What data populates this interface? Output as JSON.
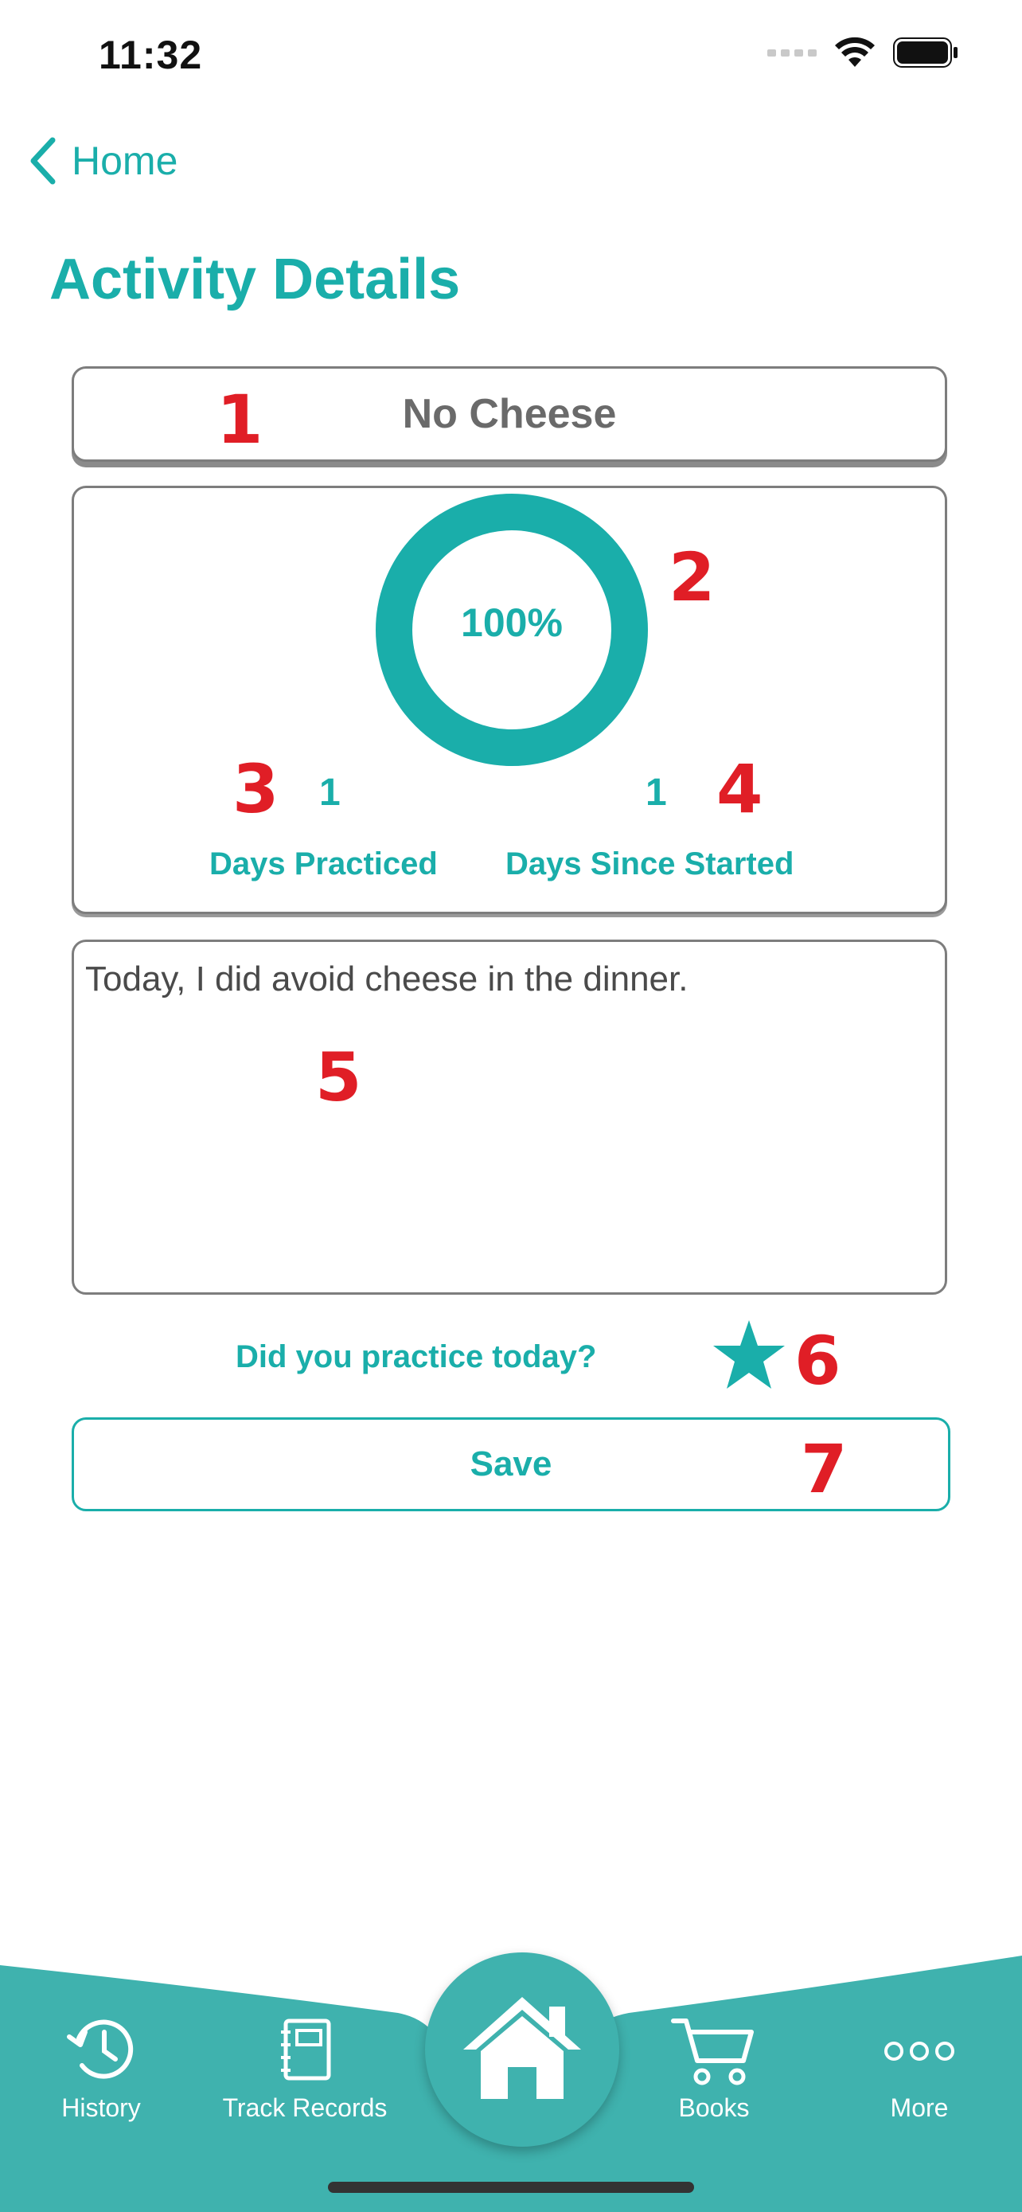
{
  "status_bar": {
    "time": "11:32"
  },
  "nav": {
    "back_label": "Home",
    "title": "Activity Details"
  },
  "activity": {
    "name": "No Cheese"
  },
  "progress": {
    "percent_label": "100%",
    "percent": 100
  },
  "stats": {
    "days_practiced_value": "1",
    "days_practiced_label": "Days Practiced",
    "days_since_started_value": "1",
    "days_since_started_label": "Days Since Started"
  },
  "notes": {
    "text": "Today, I did avoid cheese in the dinner."
  },
  "practice": {
    "question": "Did you practice today?",
    "starred": true
  },
  "save": {
    "label": "Save"
  },
  "annotations": [
    "1",
    "2",
    "3",
    "4",
    "5",
    "6",
    "7"
  ],
  "tab_bar": {
    "history": "History",
    "track_records": "Track Records",
    "books": "Books",
    "more": "More"
  },
  "colors": {
    "accent": "#1aaeaa",
    "tab_bar": "#3fb2ae",
    "annotation": "#e01e26"
  }
}
